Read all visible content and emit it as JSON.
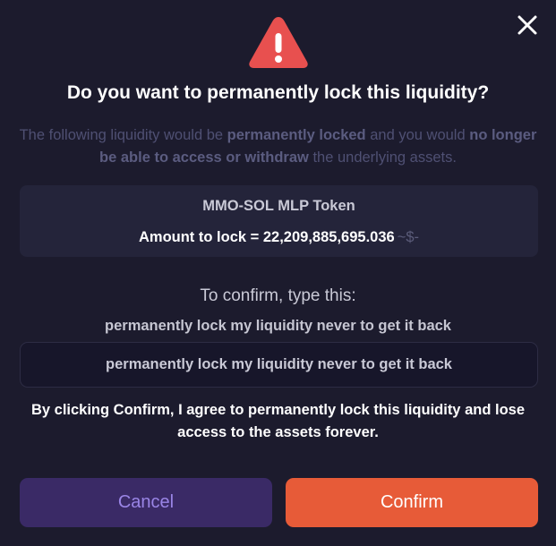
{
  "dialog": {
    "title": "Do you want to permanently lock this liquidity?",
    "description": {
      "part1": "The following liquidity would be ",
      "bold1": "permanently locked",
      "part2": " and you would ",
      "bold2": "no longer be able to access or withdraw",
      "part3": " the underlying assets."
    },
    "token": {
      "name": "MMO-SOL MLP Token",
      "amount_label": "Amount to lock = ",
      "amount_value": "22,209,885,695.036",
      "amount_usd": "~$-"
    },
    "confirm": {
      "instruction": "To confirm, type this:",
      "phrase": "permanently lock my liquidity never to get it back",
      "input_value": "permanently lock my liquidity never to get it back"
    },
    "agreement": "By clicking Confirm, I agree to permanently lock this liquidity and lose access to the assets forever.",
    "buttons": {
      "cancel": "Cancel",
      "confirm": "Confirm"
    }
  },
  "colors": {
    "background": "#1c1b2d",
    "warning": "#e8504f",
    "cancel_bg": "#3a2a66",
    "cancel_text": "#9a85e6",
    "confirm_bg": "#e75b38"
  },
  "icons": {
    "close": "close-icon",
    "warning": "warning-triangle-icon"
  }
}
